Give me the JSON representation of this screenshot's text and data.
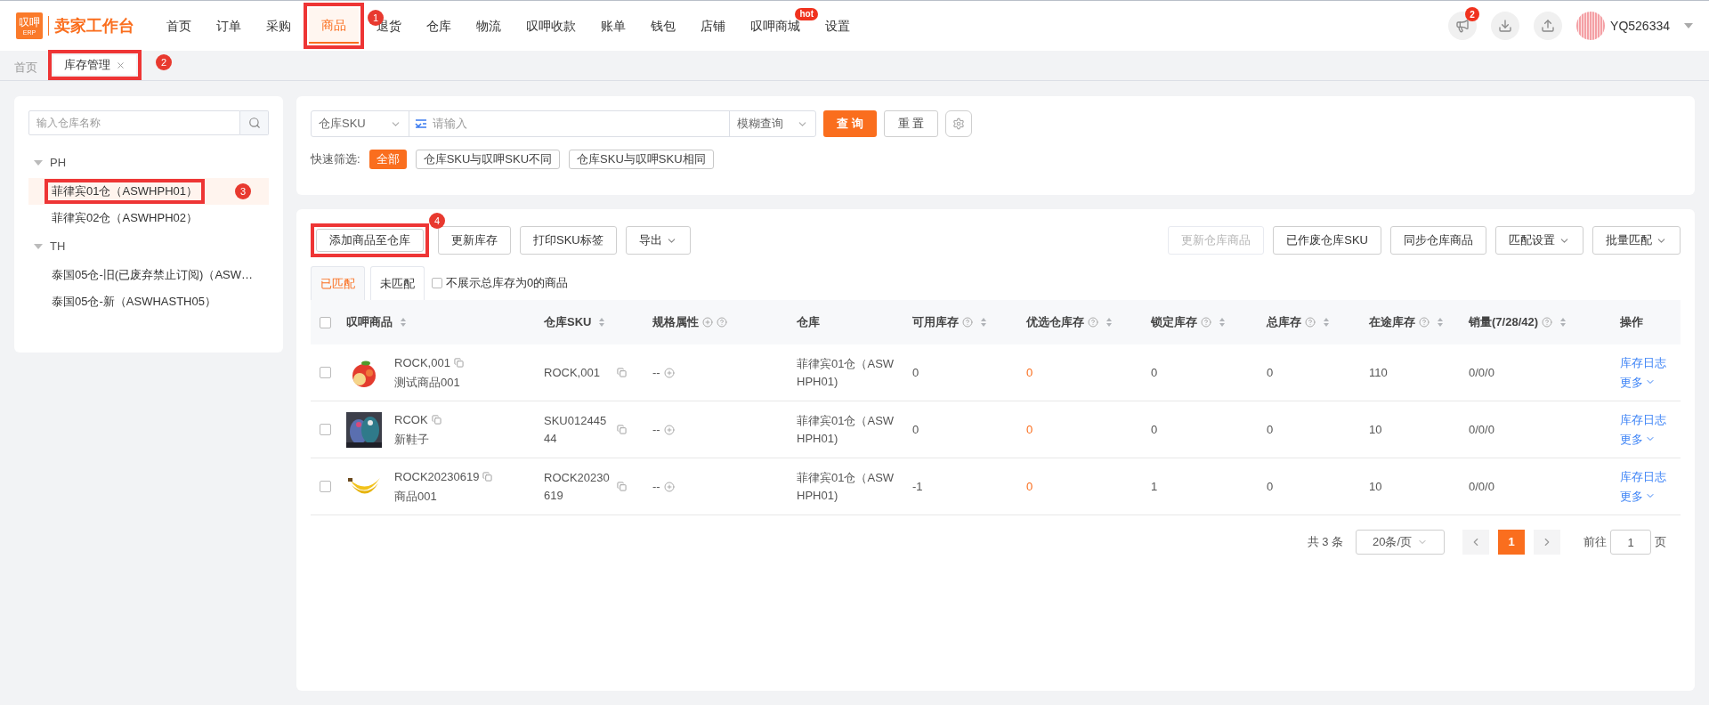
{
  "logo": {
    "mark": "叹呷",
    "sub": "ERP",
    "title": "卖家工作台"
  },
  "nav": [
    {
      "label": "首页",
      "selected": false
    },
    {
      "label": "订单",
      "selected": false
    },
    {
      "label": "采购",
      "selected": false
    },
    {
      "label": "商品",
      "selected": true,
      "boxed": true,
      "callout": "1"
    },
    {
      "label": "退货",
      "selected": false
    },
    {
      "label": "仓库",
      "selected": false
    },
    {
      "label": "物流",
      "selected": false
    },
    {
      "label": "叹呷收款",
      "selected": false
    },
    {
      "label": "账单",
      "selected": false
    },
    {
      "label": "钱包",
      "selected": false
    },
    {
      "label": "店铺",
      "selected": false
    },
    {
      "label": "叹呷商城",
      "selected": false,
      "badge": "hot"
    },
    {
      "label": "设置",
      "selected": false
    }
  ],
  "header_actions": [
    {
      "kind": "announce",
      "badge": "2"
    },
    {
      "kind": "download"
    },
    {
      "kind": "upload"
    }
  ],
  "user": {
    "name": "YQ526334"
  },
  "page_tabs": [
    {
      "label": "首页",
      "selected": false
    },
    {
      "label": "库存管理",
      "selected": true,
      "closable": true,
      "boxed": true,
      "callout": "2"
    }
  ],
  "warehouse_search": {
    "placeholder": "输入仓库名称"
  },
  "tree": [
    {
      "label": "PH",
      "expanded": true,
      "children": [
        {
          "label": "菲律宾01仓（ASWHPH01）",
          "selected": true,
          "boxed": true,
          "callout": "3"
        },
        {
          "label": "菲律宾02仓（ASWHPH02）",
          "selected": false
        }
      ]
    },
    {
      "label": "TH",
      "expanded": true,
      "children": [
        {
          "label": "泰国05仓-旧(已废弃禁止订阅)（ASW…",
          "selected": false
        },
        {
          "label": "泰国05仓-新（ASWHASTH05）",
          "selected": false
        }
      ]
    }
  ],
  "filter": {
    "field": "仓库SKU",
    "placeholder": "请输入",
    "mode": "模糊查询",
    "search_button": "查 询",
    "reset_button": "重 置",
    "quick_label": "快速筛选:",
    "quick": [
      {
        "label": "全部",
        "selected": true
      },
      {
        "label": "仓库SKU与叹呷SKU不同",
        "selected": false
      },
      {
        "label": "仓库SKU与叹呷SKU相同",
        "selected": false
      }
    ]
  },
  "toolbar_left": [
    {
      "label": "添加商品至仓库",
      "boxed": true,
      "callout": "4"
    },
    {
      "label": "更新库存"
    },
    {
      "label": "打印SKU标签"
    },
    {
      "label": "导出",
      "dropdown": true
    }
  ],
  "toolbar_right": [
    {
      "label": "更新仓库商品",
      "disabled": true
    },
    {
      "label": "已作废仓库SKU",
      "disabled": false
    },
    {
      "label": "同步仓库商品",
      "disabled": false
    },
    {
      "label": "匹配设置",
      "dropdown": true,
      "disabled": false
    },
    {
      "label": "批量匹配",
      "dropdown": true,
      "disabled": false
    }
  ],
  "match_tabs": [
    {
      "label": "已匹配",
      "selected": true
    },
    {
      "label": "未匹配",
      "selected": false
    }
  ],
  "hide_zero": {
    "label": "不展示总库存为0的商品",
    "checked": false
  },
  "table": {
    "select_all": {
      "checked": false
    },
    "columns": [
      {
        "label": "叹呷商品",
        "sort": true
      },
      {
        "label": "仓库SKU",
        "sort": true
      },
      {
        "label": "规格属性",
        "plus": true,
        "help": true
      },
      {
        "label": "仓库"
      },
      {
        "label": "可用库存",
        "help": true,
        "sort": true
      },
      {
        "label": "优选仓库存",
        "help": true,
        "sort": true
      },
      {
        "label": "锁定库存",
        "help": true,
        "sort": true
      },
      {
        "label": "总库存",
        "help": true,
        "sort": true
      },
      {
        "label": "在途库存",
        "help": true,
        "sort": true
      },
      {
        "label": "销量(7/28/42)",
        "help": true,
        "sort": true
      },
      {
        "label": "操作"
      }
    ],
    "rows": [
      {
        "checked": false,
        "sku": "ROCK,001",
        "name": "测试商品001",
        "warehouse_sku": "ROCK,001",
        "spec": "--",
        "warehouse": "菲律宾01仓（ASWHPH01)",
        "available": "0",
        "preferred": "0",
        "locked": "0",
        "total": "0",
        "transit": "110",
        "sales": "0/0/0",
        "log": "库存日志",
        "more": "更多"
      },
      {
        "checked": false,
        "sku": "RCOK",
        "name": "新鞋子",
        "warehouse_sku": "SKU01244544",
        "spec": "--",
        "warehouse": "菲律宾01仓（ASWHPH01)",
        "available": "0",
        "preferred": "0",
        "locked": "0",
        "total": "0",
        "transit": "10",
        "sales": "0/0/0",
        "log": "库存日志",
        "more": "更多"
      },
      {
        "checked": false,
        "sku": "ROCK20230619",
        "name": "商品001",
        "warehouse_sku": "ROCK20230619",
        "spec": "--",
        "warehouse": "菲律宾01仓（ASWHPH01)",
        "available": "-1",
        "preferred": "0",
        "locked": "1",
        "total": "0",
        "transit": "10",
        "sales": "0/0/0",
        "log": "库存日志",
        "more": "更多"
      }
    ]
  },
  "pagination": {
    "total": "共 3 条",
    "page_size": "20条/页",
    "pages": [
      {
        "label": "1",
        "selected": true
      }
    ],
    "goto_label": "前往",
    "goto_value": "1",
    "goto_suffix": "页"
  }
}
